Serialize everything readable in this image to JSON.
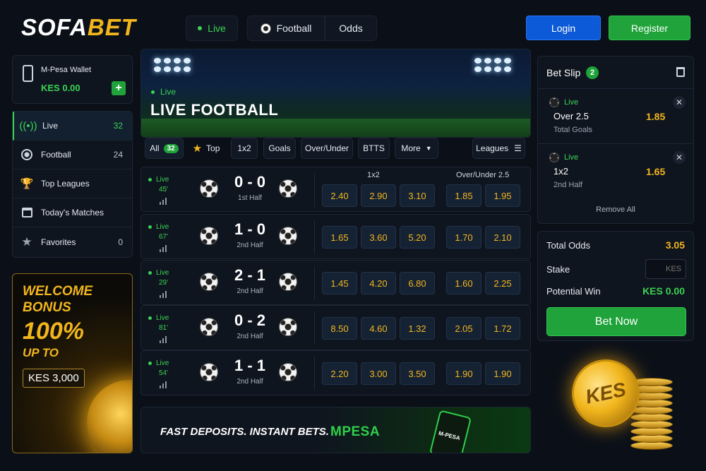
{
  "brand": {
    "part1": "SOFA",
    "part2": "BET"
  },
  "nav": {
    "live": "Live",
    "football": "Football",
    "odds": "Odds"
  },
  "auth": {
    "login": "Login",
    "register": "Register"
  },
  "wallet": {
    "title": "M-Pesa Wallet",
    "balance": "KES 0.00",
    "add": "+"
  },
  "sidebar": {
    "items": [
      {
        "label": "Live",
        "count": "32",
        "icon": "live-signal-icon"
      },
      {
        "label": "Football",
        "count": "24",
        "icon": "football-icon"
      },
      {
        "label": "Top Leagues",
        "count": "",
        "icon": "trophy-icon"
      },
      {
        "label": "Today's Matches",
        "count": "",
        "icon": "calendar-icon"
      },
      {
        "label": "Favorites",
        "count": "0",
        "icon": "star-icon"
      }
    ]
  },
  "promo": {
    "line1": "WELCOME",
    "line2": "BONUS",
    "line3": "100%",
    "line4": "UP TO",
    "amount": "KES 3,000"
  },
  "hero": {
    "tag": "Live",
    "title": "LIVE FOOTBALL"
  },
  "filters": {
    "all": "All",
    "all_count": "32",
    "top": "Top",
    "x12": "1x2",
    "goals": "Goals",
    "overunder": "Over/Under",
    "btts": "BTTS",
    "more": "More",
    "leagues": "Leagues"
  },
  "match_headers": {
    "x12": "1x2",
    "ou": "Over/Under 2.5"
  },
  "matches": [
    {
      "status": "Live",
      "minute": "45'",
      "score": "0 - 0",
      "period": "1st Half",
      "odds": [
        "2.40",
        "2.90",
        "3.10",
        "1.85",
        "1.95"
      ]
    },
    {
      "status": "Live",
      "minute": "67'",
      "score": "1 - 0",
      "period": "2nd Half",
      "odds": [
        "1.65",
        "3.60",
        "5.20",
        "1.70",
        "2.10"
      ]
    },
    {
      "status": "Live",
      "minute": "29'",
      "score": "2 - 1",
      "period": "2nd Half",
      "odds": [
        "1.45",
        "4.20",
        "6.80",
        "1.60",
        "2.25"
      ]
    },
    {
      "status": "Live",
      "minute": "81'",
      "score": "0 - 2",
      "period": "2nd Half",
      "odds": [
        "8.50",
        "4.60",
        "1.32",
        "2.05",
        "1.72"
      ]
    },
    {
      "status": "Live",
      "minute": "54'",
      "score": "1 - 1",
      "period": "2nd Half",
      "odds": [
        "2.20",
        "3.00",
        "3.50",
        "1.90",
        "1.90"
      ]
    }
  ],
  "banner": {
    "text": "FAST DEPOSITS. INSTANT BETS.",
    "brand": "MPESA",
    "phone_brand": "M-PESA"
  },
  "betslip": {
    "title": "Bet Slip",
    "count": "2",
    "selections": [
      {
        "status": "Live",
        "pick": "Over 2.5",
        "odd": "1.85",
        "market": "Total Goals"
      },
      {
        "status": "Live",
        "pick": "1x2",
        "odd": "1.65",
        "market": "2nd Half"
      }
    ],
    "remove_all": "Remove All"
  },
  "totals": {
    "odds_label": "Total Odds",
    "odds_value": "3.05",
    "stake_label": "Stake",
    "stake_placeholder": "KES",
    "win_label": "Potential Win",
    "win_value": "KES 0.00",
    "bet_now": "Bet Now"
  },
  "coin": {
    "label": "KES"
  },
  "colors": {
    "accent_green": "#39d353",
    "gold": "#f2b61c",
    "login_blue": "#0d5ad9",
    "register_green": "#1fa33a"
  }
}
